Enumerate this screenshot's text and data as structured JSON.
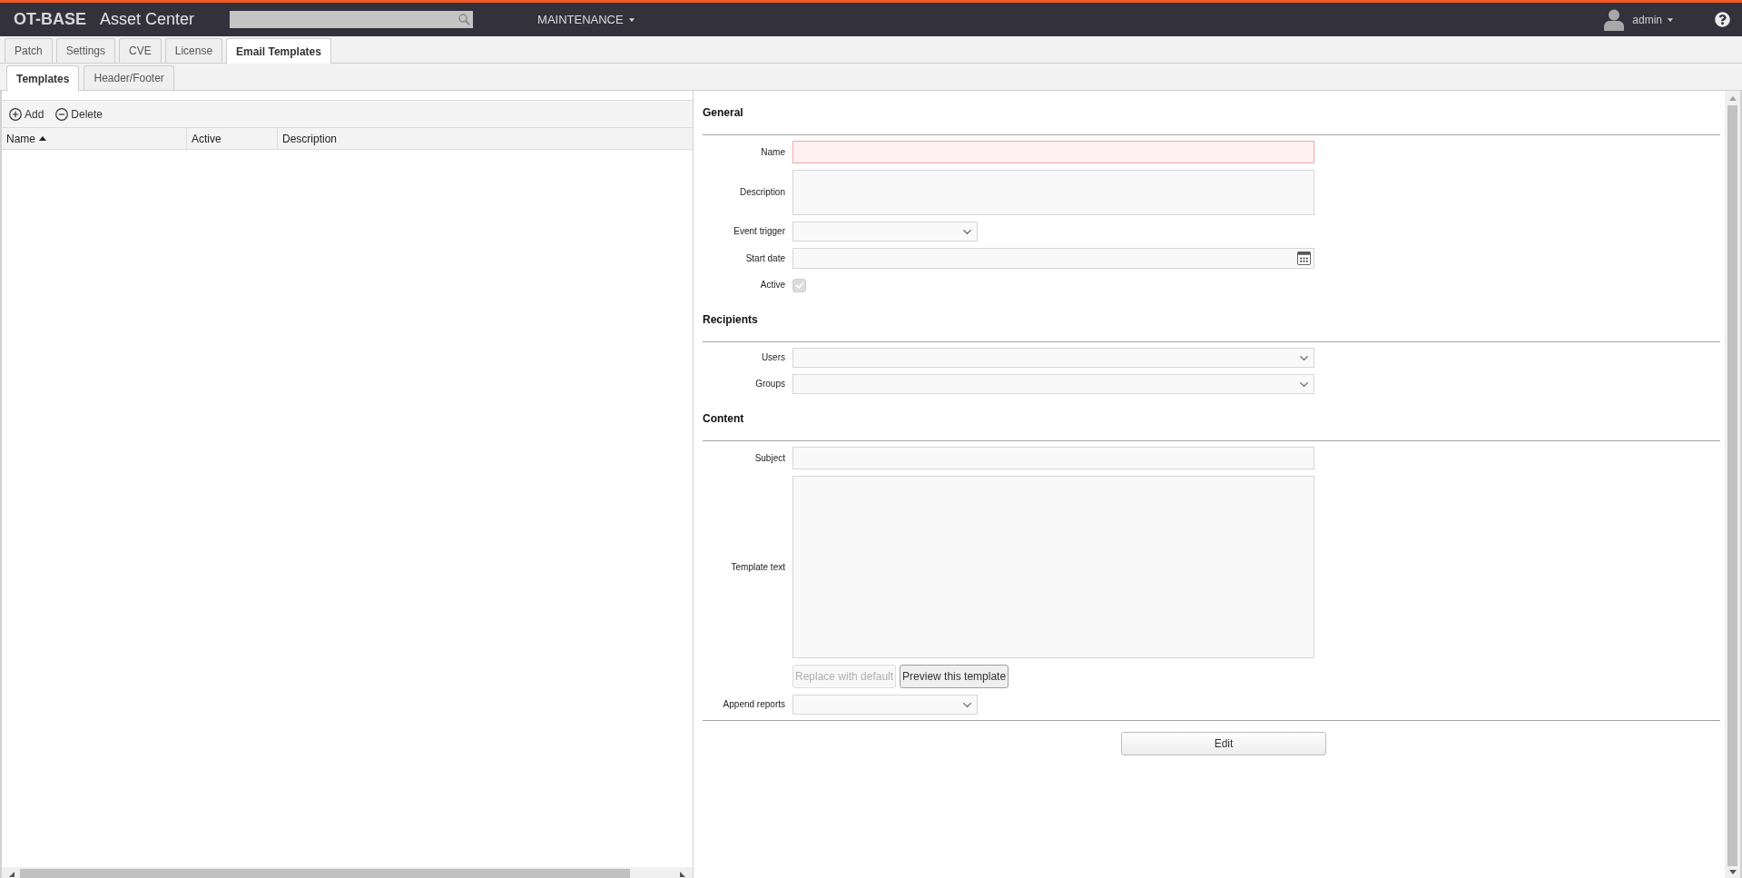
{
  "header": {
    "logo": "OT-BASE",
    "title": "Asset Center",
    "menu": "MAINTENANCE",
    "user": "admin"
  },
  "tabs": [
    {
      "label": "Patch",
      "selected": false
    },
    {
      "label": "Settings",
      "selected": false
    },
    {
      "label": "CVE",
      "selected": false
    },
    {
      "label": "License",
      "selected": false
    },
    {
      "label": "Email Templates",
      "selected": true
    }
  ],
  "subtabs": [
    {
      "label": "Templates",
      "selected": true
    },
    {
      "label": "Header/Footer",
      "selected": false
    }
  ],
  "toolbar": [
    {
      "kind": "add",
      "label": "Add"
    },
    {
      "kind": "delete",
      "label": "Delete"
    }
  ],
  "table": {
    "columns": [
      {
        "label": "Name",
        "sorted_ascending": true
      },
      {
        "label": "Active"
      },
      {
        "label": "Description"
      }
    ]
  },
  "form": {
    "sections": [
      {
        "title": "General",
        "fields": [
          {
            "kind": "text",
            "label": "Name",
            "invalid": true
          },
          {
            "kind": "textarea",
            "label": "Description"
          },
          {
            "kind": "select",
            "label": "Event trigger"
          },
          {
            "kind": "date",
            "label": "Start date"
          },
          {
            "kind": "checkbox",
            "label": "Active",
            "checked": true,
            "disabled": true
          }
        ]
      },
      {
        "title": "Recipients",
        "fields": [
          {
            "kind": "multiselect",
            "label": "Users"
          },
          {
            "kind": "multiselect",
            "label": "Groups"
          }
        ]
      },
      {
        "title": "Content",
        "fields": [
          {
            "kind": "text",
            "label": "Subject",
            "invalid": false
          },
          {
            "kind": "editor",
            "label": "Template text"
          },
          {
            "kind": "buttons",
            "buttons": [
              {
                "label": "Replace with default",
                "disabled": true
              },
              {
                "label": "Preview this template",
                "disabled": false
              }
            ]
          },
          {
            "kind": "select",
            "label": "Append reports"
          }
        ]
      }
    ],
    "footer_button": {
      "label": "Edit"
    }
  }
}
